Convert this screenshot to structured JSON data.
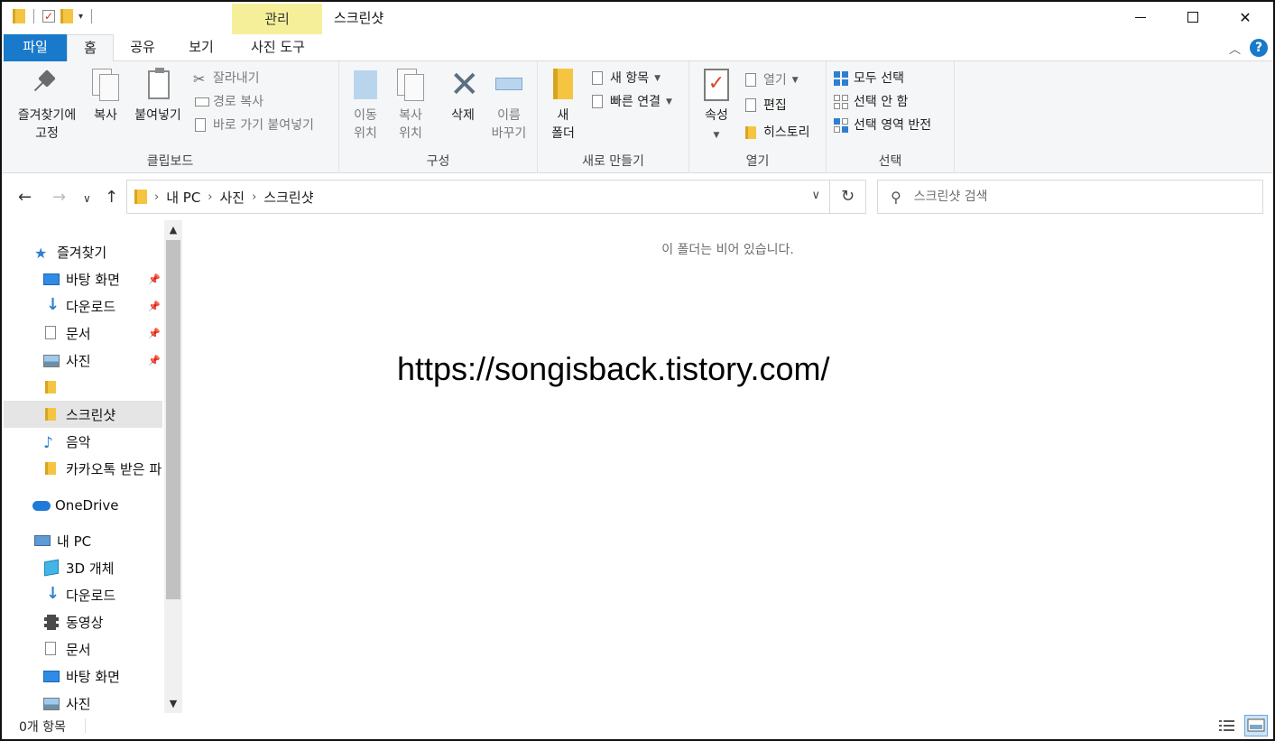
{
  "window": {
    "title": "스크린샷",
    "context_tab_group": "관리",
    "minimize_glyph": "",
    "close_glyph": "✕"
  },
  "qat": {
    "dropdown_glyph": "▾"
  },
  "tabs": [
    {
      "label": "파일"
    },
    {
      "label": "홈"
    },
    {
      "label": "공유"
    },
    {
      "label": "보기"
    },
    {
      "label": "사진 도구"
    }
  ],
  "ribbon": {
    "clipboard": {
      "label": "클립보드",
      "pin": "즐겨찾기에\n고정",
      "copy": "복사",
      "paste": "붙여넣기",
      "cut": "잘라내기",
      "copy_path": "경로 복사",
      "paste_shortcut": "바로 가기 붙여넣기"
    },
    "organize": {
      "label": "구성",
      "move_to": "이동\n위치",
      "copy_to": "복사\n위치",
      "delete": "삭제",
      "rename": "이름\n바꾸기"
    },
    "new": {
      "label": "새로 만들기",
      "new_folder": "새\n폴더",
      "new_item": "새 항목",
      "easy_access": "빠른 연결"
    },
    "open": {
      "label": "열기",
      "properties": "속성",
      "open": "열기",
      "edit": "편집",
      "history": "히스토리"
    },
    "select": {
      "label": "선택",
      "select_all": "모두 선택",
      "select_none": "선택 안 함",
      "invert": "선택 영역 반전"
    }
  },
  "address": {
    "crumbs": [
      "내 PC",
      "사진",
      "스크린샷"
    ],
    "search_placeholder": "스크린샷 검색"
  },
  "nav": {
    "quick_access": "즐겨찾기",
    "items": [
      {
        "label": "바탕 화면"
      },
      {
        "label": "다운로드"
      },
      {
        "label": "문서"
      },
      {
        "label": "사진"
      },
      {
        "label": ""
      },
      {
        "label": "스크린샷"
      },
      {
        "label": "음악"
      },
      {
        "label": "카카오톡 받은 파"
      }
    ],
    "onedrive": "OneDrive",
    "this_pc": "내 PC",
    "pc_items": [
      {
        "label": "3D 개체"
      },
      {
        "label": "다운로드"
      },
      {
        "label": "동영상"
      },
      {
        "label": "문서"
      },
      {
        "label": "바탕 화면"
      },
      {
        "label": "사진"
      }
    ]
  },
  "content": {
    "empty_message": "이 폴더는 비어 있습니다.",
    "watermark": "https://songisback.tistory.com/"
  },
  "status": {
    "item_count": "0개 항목"
  },
  "colors": {
    "file_tab": "#1979ca",
    "context_tab": "#f6ef9a",
    "selection": "#e5e5e5"
  }
}
